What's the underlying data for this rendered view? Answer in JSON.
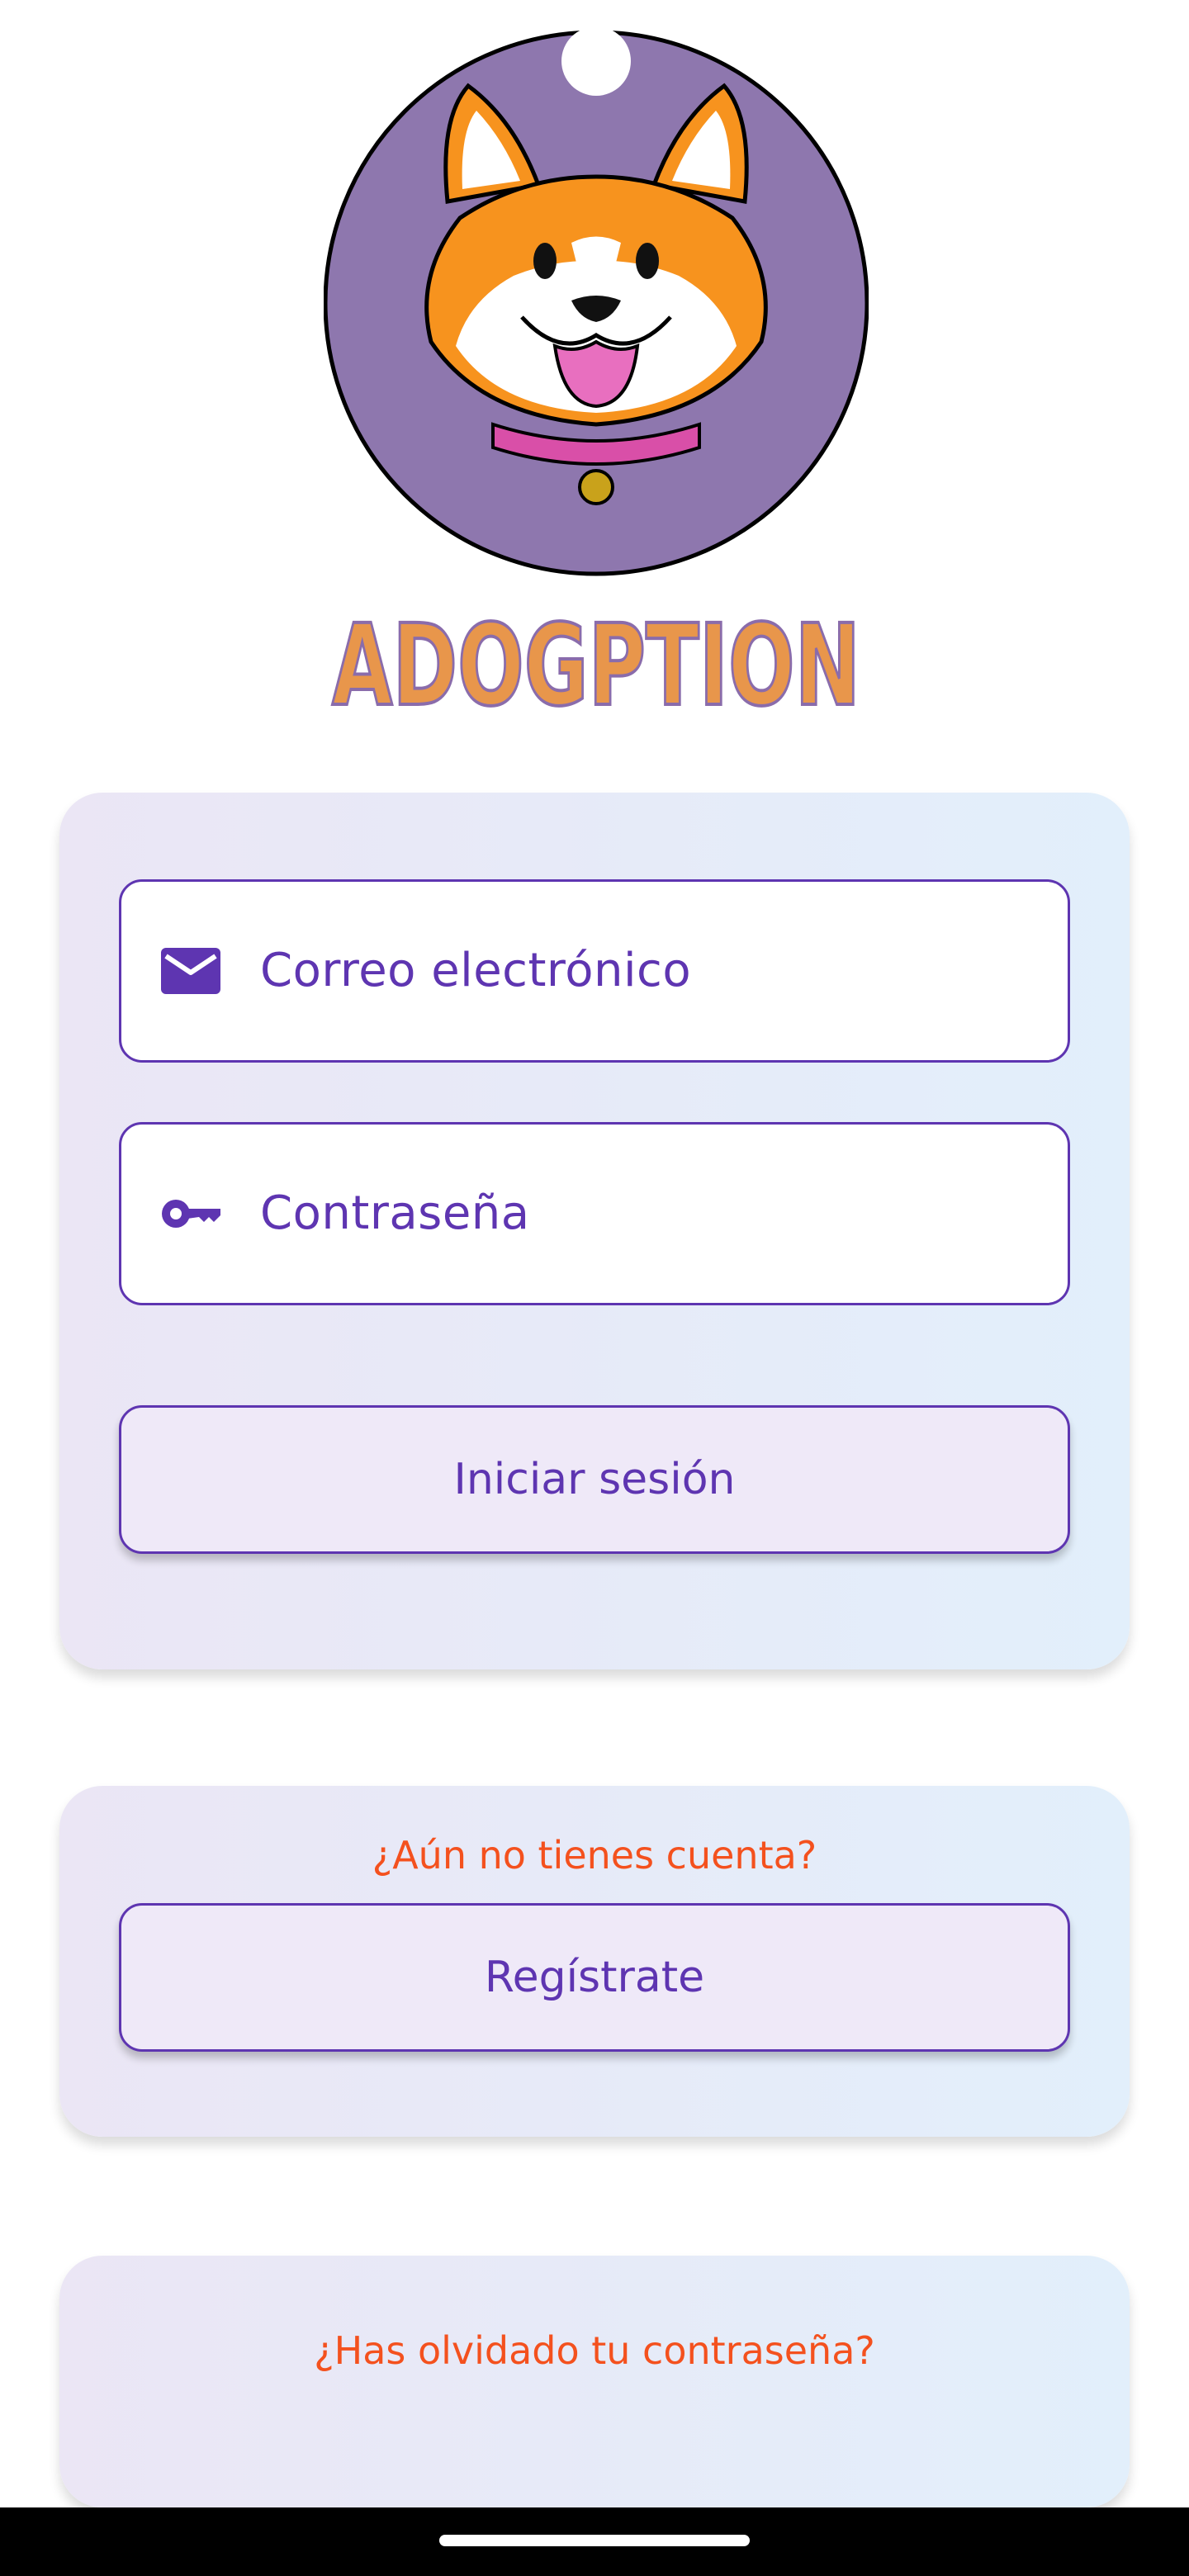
{
  "app": {
    "name": "ADOGPTION"
  },
  "logo": {
    "icon": "corgi-dog-icon",
    "background_color": "#8e77ae"
  },
  "login_form": {
    "email_placeholder": "Correo electrónico",
    "email_icon": "mail-icon",
    "password_placeholder": "Contraseña",
    "password_icon": "key-icon",
    "submit_label": "Iniciar sesión"
  },
  "register": {
    "prompt": "¿Aún no tienes cuenta?",
    "button_label": "Regístrate"
  },
  "forgot_password": {
    "link_text": "¿Has olvidado tu contraseña?"
  },
  "colors": {
    "primary": "#5e35b1",
    "accent": "#f4511e",
    "brand_orange": "#e8964b"
  }
}
